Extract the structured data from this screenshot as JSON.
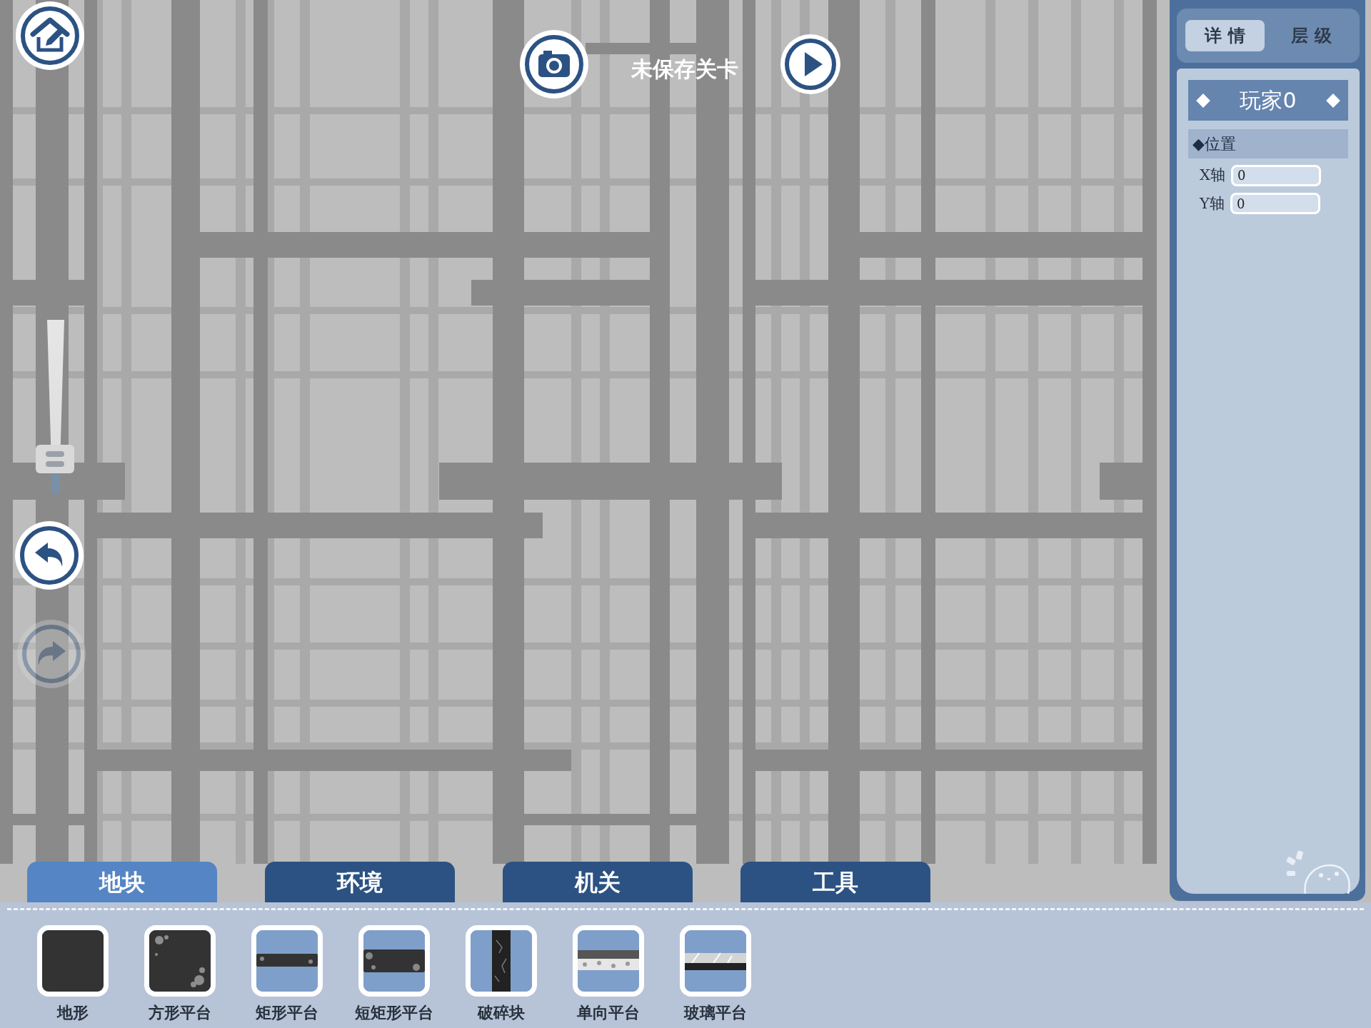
{
  "header": {
    "title": "未保存关卡"
  },
  "zoom_slider": {
    "level": 0.2
  },
  "history_buttons": [
    {
      "kind": "undo",
      "disabled": false
    },
    {
      "kind": "redo",
      "disabled": true
    }
  ],
  "side_panel": {
    "tabs": [
      {
        "label": "详 情",
        "selected": true
      },
      {
        "label": "层 级",
        "selected": false
      }
    ],
    "object_name": "玩家0",
    "section": "◆位置",
    "fields": [
      {
        "label": "X轴",
        "value": "0"
      },
      {
        "label": "Y轴",
        "value": "0"
      }
    ]
  },
  "category_tabs": [
    {
      "label": "地块",
      "selected": true
    },
    {
      "label": "环境",
      "selected": false
    },
    {
      "label": "机关",
      "selected": false
    },
    {
      "label": "工具",
      "selected": false
    }
  ],
  "palette_items": [
    {
      "label": "地形",
      "kind": "terrain"
    },
    {
      "label": "方形平台",
      "kind": "square"
    },
    {
      "label": "矩形平台",
      "kind": "rect"
    },
    {
      "label": "短矩形平台",
      "kind": "short-rect"
    },
    {
      "label": "破碎块",
      "kind": "breakable"
    },
    {
      "label": "单向平台",
      "kind": "one-way"
    },
    {
      "label": "玻璃平台",
      "kind": "glass"
    }
  ]
}
